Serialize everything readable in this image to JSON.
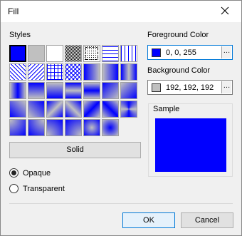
{
  "window": {
    "title": "Fill"
  },
  "styles": {
    "label": "Styles",
    "selected_index": 0,
    "solid_button_label": "Solid"
  },
  "fill_mode": {
    "options": [
      "Opaque",
      "Transparent"
    ],
    "selected": "Opaque"
  },
  "foreground": {
    "label": "Foreground Color",
    "value": "0, 0, 255",
    "color": "#0000ff"
  },
  "background": {
    "label": "Background Color",
    "value": "192, 192, 192",
    "color": "#c0c0c0"
  },
  "sample": {
    "label": "Sample"
  },
  "buttons": {
    "ok": "OK",
    "cancel": "Cancel"
  },
  "colors": {
    "accent": "#0078d7",
    "fg": "#0000ff",
    "bg": "#c0c0c0"
  }
}
